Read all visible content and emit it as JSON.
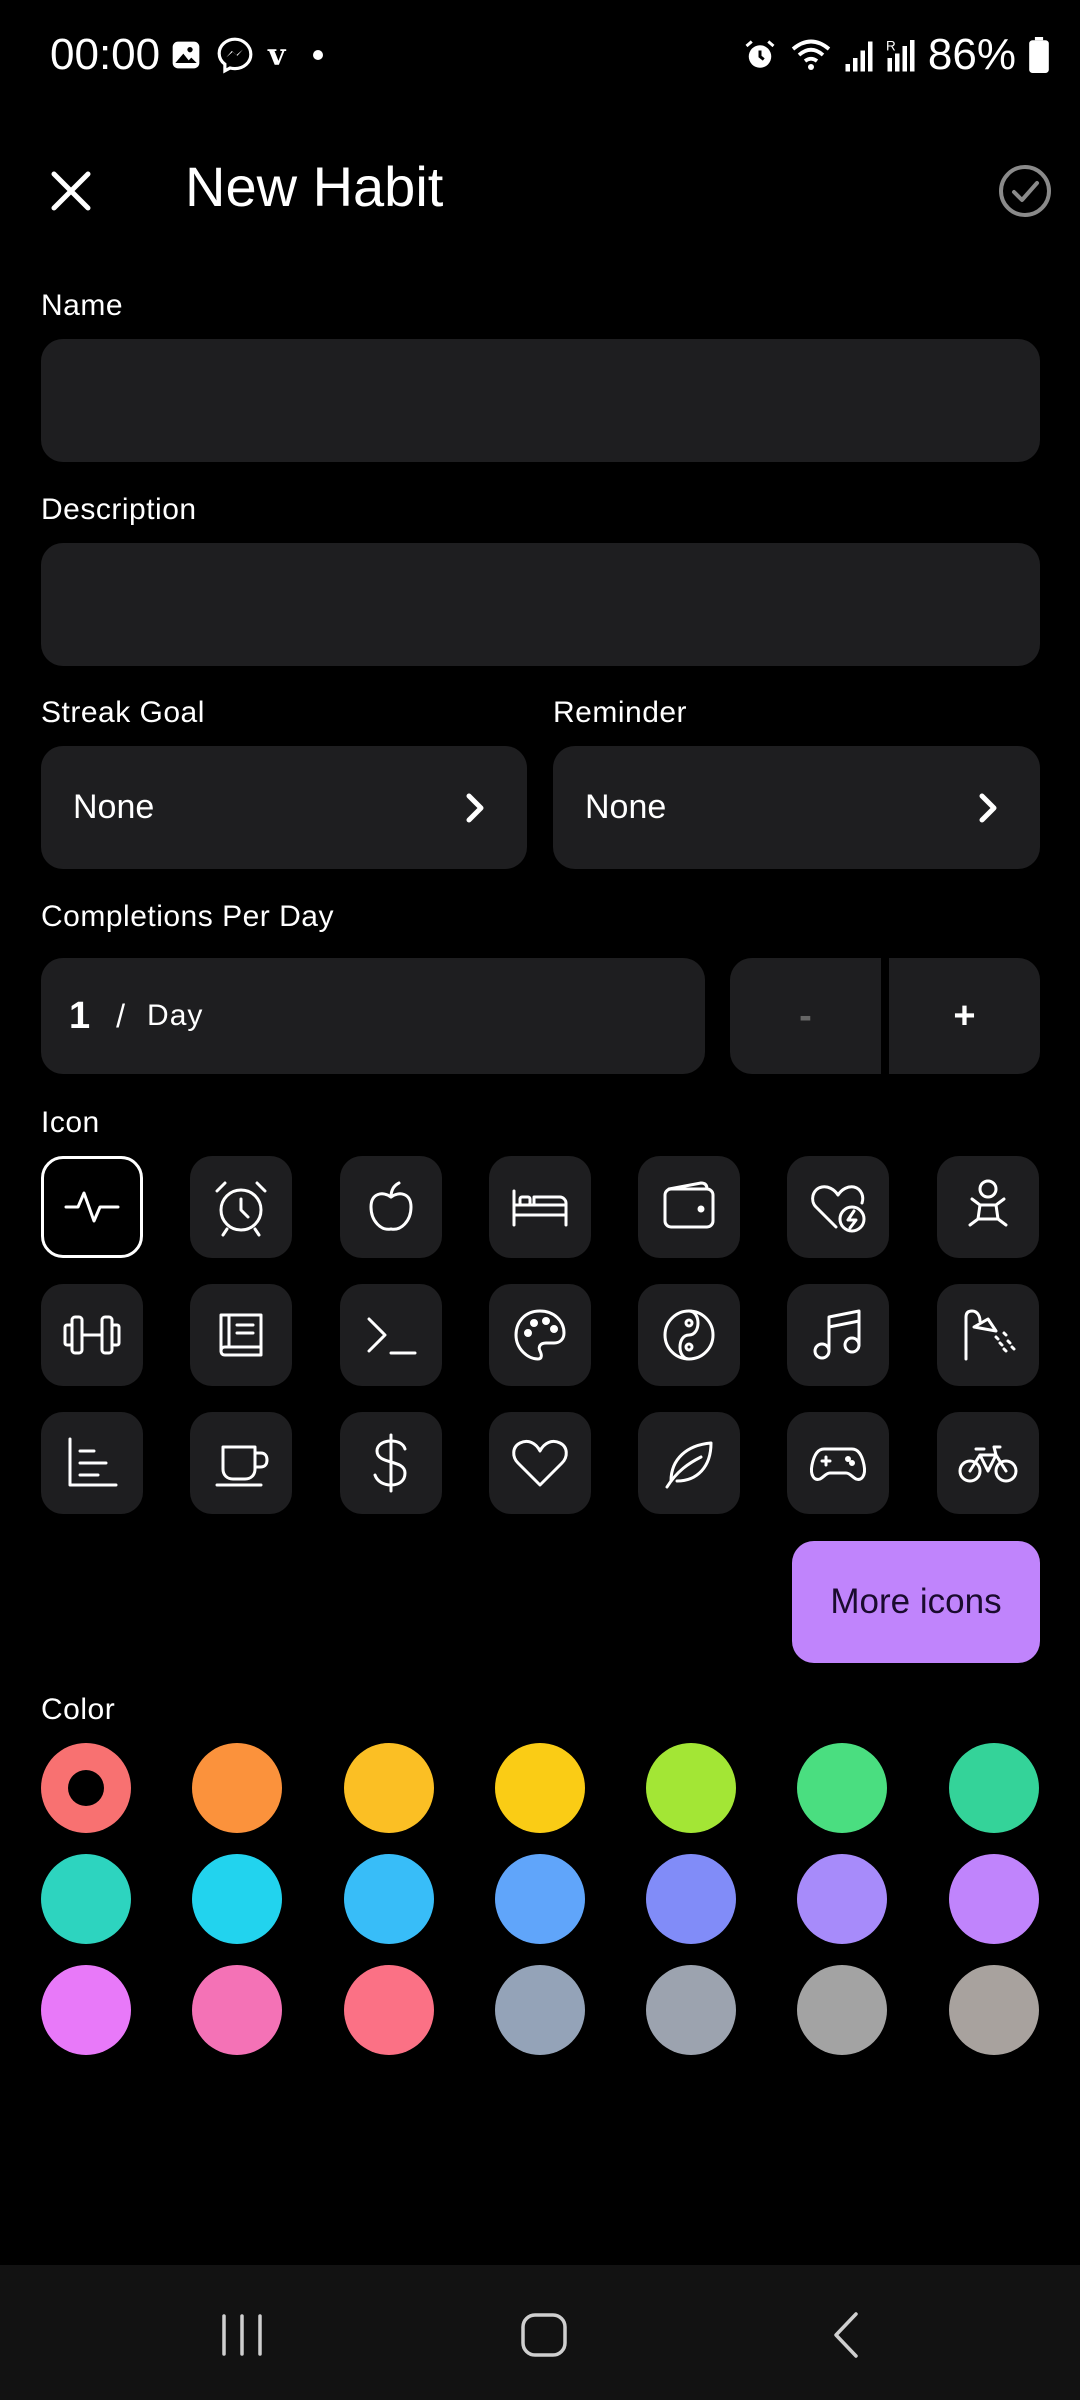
{
  "status_bar": {
    "time": "00:00",
    "battery": "86%",
    "left_icons": [
      "gallery-icon",
      "messenger-icon",
      "v-icon",
      "dot-icon"
    ],
    "right_icons": [
      "alarm-icon",
      "wifi-icon",
      "signal-icon",
      "signal-r-icon",
      "battery-icon"
    ]
  },
  "appbar": {
    "title": "New Habit",
    "close_icon": "close-icon",
    "confirm_icon": "check-circle-icon"
  },
  "form": {
    "name_label": "Name",
    "name_value": "",
    "description_label": "Description",
    "description_value": "",
    "streak_label": "Streak Goal",
    "streak_value": "None",
    "reminder_label": "Reminder",
    "reminder_value": "None",
    "completions_label": "Completions Per Day",
    "completions_value": "1",
    "completions_sep": "/",
    "completions_unit": "Day",
    "minus_label": "-",
    "plus_label": "+",
    "icon_label": "Icon",
    "more_icons_label": "More icons",
    "color_label": "Color"
  },
  "icons": [
    "heartbeat-icon",
    "alarm-clock-icon",
    "apple-icon",
    "bed-icon",
    "wallet-icon",
    "heart-bolt-icon",
    "baby-icon",
    "dumbbell-icon",
    "book-icon",
    "terminal-icon",
    "palette-icon",
    "yin-yang-icon",
    "music-icon",
    "shower-icon",
    "bar-chart-icon",
    "coffee-icon",
    "dollar-icon",
    "heart-icon",
    "leaf-icon",
    "gamepad-icon",
    "bicycle-icon"
  ],
  "selected_icon_index": 0,
  "colors": [
    "#f87171",
    "#fb923c",
    "#fbbf24",
    "#facc15",
    "#a3e635",
    "#4ade80",
    "#34d399",
    "#2dd4bf",
    "#22d3ee",
    "#38bdf8",
    "#60a5fa",
    "#818cf8",
    "#a78bfa",
    "#c084fc",
    "#e879f9",
    "#f472b6",
    "#fb7185",
    "#94a3b8",
    "#9ca3af",
    "#a3a3a3",
    "#a8a29e"
  ],
  "selected_color_index": 0,
  "nav": [
    "recent-apps-icon",
    "home-icon",
    "back-icon"
  ]
}
